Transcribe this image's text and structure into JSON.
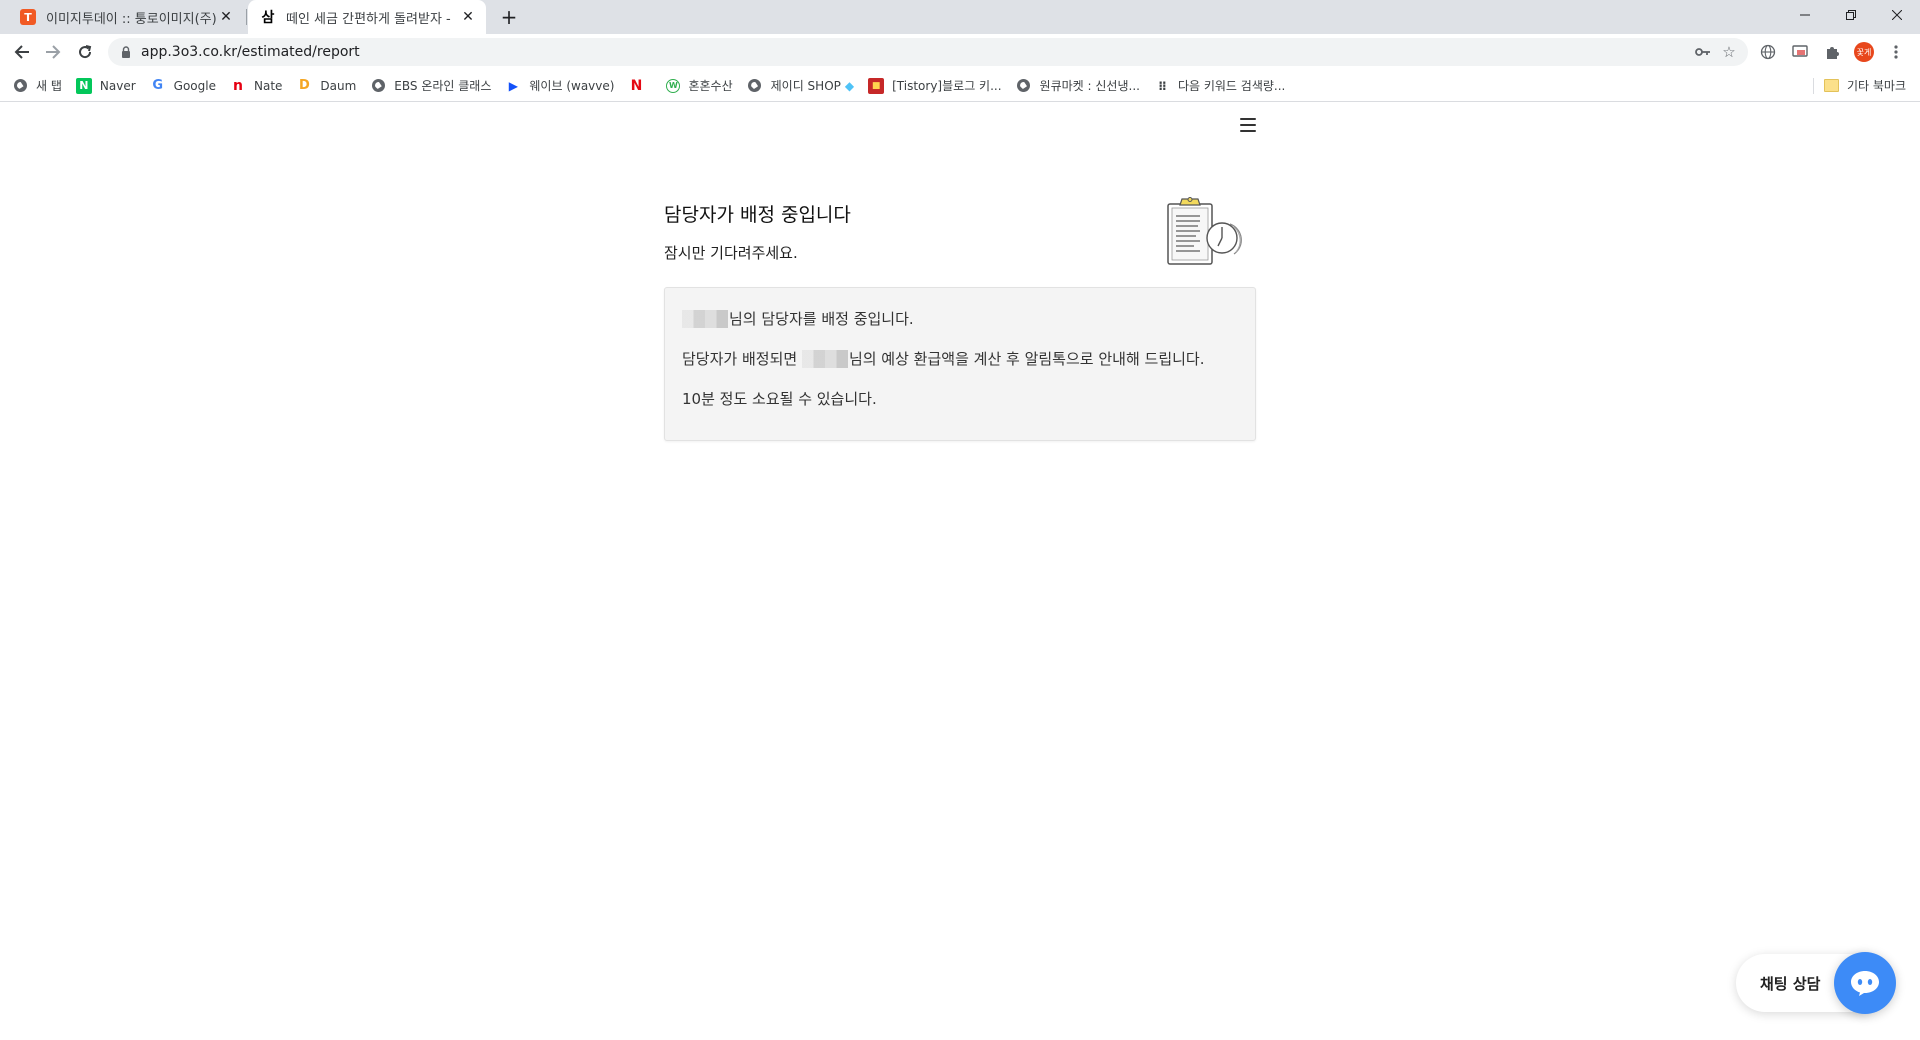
{
  "browser": {
    "tabs": [
      {
        "title": "이미지투데이 :: 퉁로이미지(주)",
        "favicon": "T",
        "active": false
      },
      {
        "title": "떼인 세금 간편하게 돌려받자 - ",
        "favicon": "삼",
        "active": true
      }
    ],
    "url": "app.3o3.co.kr/estimated/report",
    "profile_label": "꽃게",
    "bookmarks": [
      {
        "label": "새 탭",
        "icon": "globe-icon"
      },
      {
        "label": "Naver",
        "icon": "naver-icon"
      },
      {
        "label": "Google",
        "icon": "google-icon"
      },
      {
        "label": "Nate",
        "icon": "nate-icon"
      },
      {
        "label": "Daum",
        "icon": "daum-icon"
      },
      {
        "label": "EBS 온라인 클래스",
        "icon": "globe-icon"
      },
      {
        "label": "웨이브 (wavve)",
        "icon": "wavve-icon"
      },
      {
        "label": "",
        "icon": "netflix-icon"
      },
      {
        "label": "혼혼수산",
        "icon": "shop-icon"
      },
      {
        "label": "제이디 SHOP",
        "icon": "globe-icon"
      },
      {
        "label": "[Tistory]블로그 키...",
        "icon": "tistory-icon"
      },
      {
        "label": "원큐마켓 : 신선냉...",
        "icon": "globe-icon"
      },
      {
        "label": "다음 키워드 검색량...",
        "icon": "dots-icon"
      }
    ],
    "other_bookmarks": "기타 북마크"
  },
  "page": {
    "heading": "담당자가 배정 중입니다",
    "subheading": "잠시만 기다려주세요.",
    "card": {
      "line1": "님의 담당자를 배정 중입니다.",
      "line2_prefix": "담당자가 배정되면 ",
      "line2_suffix": "님의 예상 환급액을 계산 후 알림톡으로 안내해 드립니다.",
      "line3": "10분 정도 소요될 수 있습니다."
    },
    "chat_label": "채팅 상담"
  },
  "colors": {
    "chat_button": "#3d8bf7",
    "tab_strip": "#dee1e6",
    "card_bg": "#f4f4f4"
  }
}
